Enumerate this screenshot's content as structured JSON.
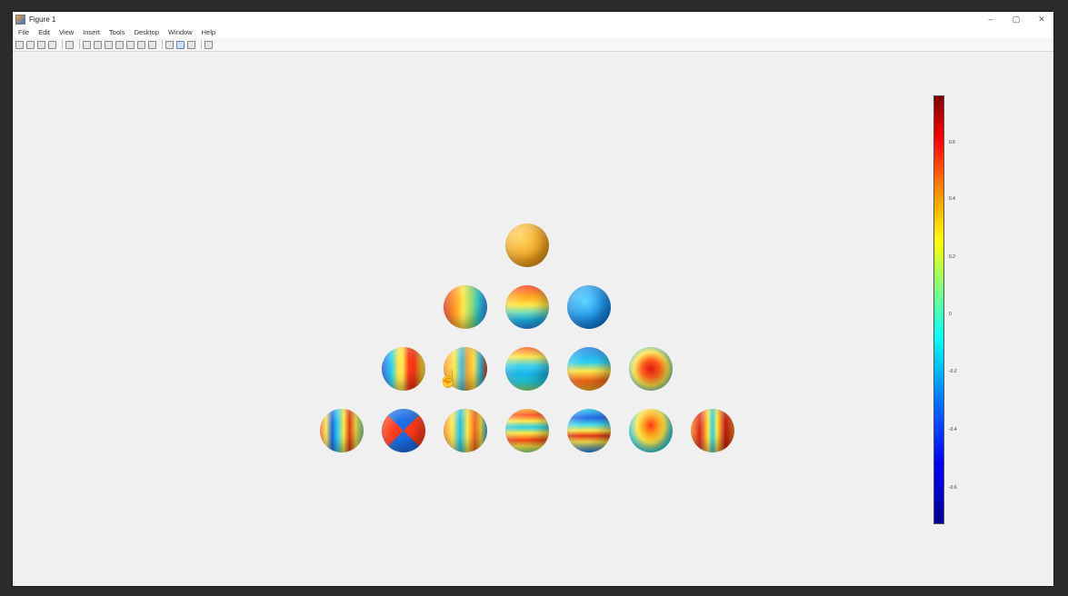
{
  "window": {
    "title": "Figure 1",
    "controls": [
      "–",
      "▢",
      "✕"
    ]
  },
  "menubar": {
    "items": [
      "File",
      "Edit",
      "View",
      "Insert",
      "Tools",
      "Desktop",
      "Window",
      "Help"
    ]
  },
  "toolbar": {
    "buttons": [
      "new-figure-icon",
      "open-icon",
      "save-icon",
      "print-icon",
      "edit-plot-icon",
      "zoom-in-icon",
      "zoom-out-icon",
      "pan-icon",
      "rotate-icon",
      "data-cursor-icon",
      "brush-icon",
      "link-icon",
      "insert-colorbar-icon",
      "insert-legend-icon",
      "hide-plot-tools-icon",
      "show-plot-tools-icon"
    ]
  },
  "figure": {
    "colorbar": {
      "ticks": [
        "0.6",
        "0.4",
        "0.2",
        "0",
        "-0.2",
        "-0.4",
        "-0.6"
      ],
      "colormap": [
        "#00008f",
        "#0000ff",
        "#00ffff",
        "#ffff00",
        "#ff0000",
        "#800000"
      ]
    },
    "spheres": [
      {
        "row": 0,
        "col": 0,
        "bg": "radial-gradient(circle at 35% 30%, #ffd86a, #f5a623 55%, #d98a10)"
      },
      {
        "row": 1,
        "col": 0,
        "bg": "linear-gradient(90deg, #e23b18 0%, #ff8a1a 22%, #ffe84a 45%, #8fe07a 65%, #2ad0e0 82%, #3a8ef0 100%)"
      },
      {
        "row": 1,
        "col": 1,
        "bg": "linear-gradient(180deg, #ff3a1a 0%, #ffa51e 25%, #ffe84a 45%, #7de3b8 62%, #1ab6ea 80%, #2a86e8 100%)"
      },
      {
        "row": 1,
        "col": 2,
        "bg": "radial-gradient(circle at 40% 35%, #5fd8ff, #1a8de8 55%, #0a5fc8)"
      },
      {
        "row": 2,
        "col": 0,
        "bg": "linear-gradient(90deg, #1a4fe0 0%, #1ad0f0 22%, #ffe84a 38%, #ffe84a 48%, #ff3a18 62%, #ff3a18 75%, #ffc22a 90%, #ffe84a 100%)"
      },
      {
        "row": 2,
        "col": 1,
        "bg": "linear-gradient(90deg, #ff9a20 0%, #ffe84a 25%, #3ac0ef 42%, #ffa52a 55%, #ffe84a 70%, #2ac8e8 85%, #e83a1a 100%)"
      },
      {
        "row": 2,
        "col": 2,
        "bg": "linear-gradient(180deg, #ff5a1a 0%, #ffe84a 22%, #44d2ec 42%, #1ab6ea 62%, #26d6e0 82%, #8ee07a 100%)"
      },
      {
        "row": 2,
        "col": 3,
        "bg": "linear-gradient(180deg, #1a7ee8 0%, #2acff0 35%, #ffe84a 55%, #ff6a1a 78%, #ffb21e 100%)"
      },
      {
        "row": 2,
        "col": 4,
        "bg": "radial-gradient(ellipse at 50% 50%, #d81a10 0%, #ff5a1a 28%, #ffe84a 55%, #3ac8e8 85%)"
      },
      {
        "row": 3,
        "col": 0,
        "bg": "linear-gradient(90deg, #ff6a1a 0%, #ffe84a 14%, #1a5ee8 28%, #2ad0ee 40%, #ffe84a 55%, #e83a18 68%, #ffe84a 82%, #7ed8a0 100%)"
      },
      {
        "row": 3,
        "col": 1,
        "bg": "conic-gradient(from 45deg, #ff3a1a 0 25%, #1a6ee8 25% 50%, #ff3a1a 50% 75%, #1a6ee8 75% 100%)"
      },
      {
        "row": 3,
        "col": 2,
        "bg": "linear-gradient(90deg, #ff8a1a 0%, #ffe84a 20%, #1ac0f0 38%, #ffe84a 55%, #ff6a1a 72%, #ffe84a 86%, #2aa8ea 100%)"
      },
      {
        "row": 3,
        "col": 3,
        "bg": "linear-gradient(180deg, #ffb21e 0%, #ff4a18 14%, #ffe84a 28%, #2ad0ee 42%, #ffe84a 56%, #ff4a18 72%, #ffe84a 86%, #8ee07a 100%)"
      },
      {
        "row": 3,
        "col": 4,
        "bg": "linear-gradient(180deg, #1ad0ee 0%, #1a5ee8 20%, #44d8e8 36%, #ffe84a 50%, #e83a18 62%, #ffe84a 76%, #1a7ee8 100%)"
      },
      {
        "row": 3,
        "col": 5,
        "bg": "radial-gradient(ellipse at 50% 38%, #ff3a18 0%, #ffa51e 25%, #ffe84a 45%, #2acce8 72%, #1a9ae8 100%)"
      },
      {
        "row": 3,
        "col": 6,
        "bg": "linear-gradient(90deg, #ff8a1a 0%, #d81a10 20%, #ffe84a 40%, #2ad0ee 50%, #ffe84a 60%, #d81a10 80%, #ff8a1a 100%)"
      }
    ]
  }
}
